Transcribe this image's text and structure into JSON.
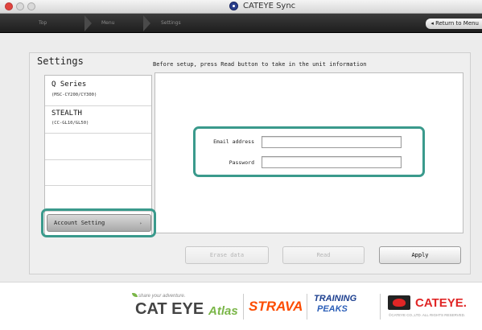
{
  "window": {
    "title": "CATEYE Sync"
  },
  "nav": {
    "crumbs": [
      "Top",
      "Menu",
      "Settings"
    ],
    "return_label": "◂ Return to Menu"
  },
  "settings": {
    "title": "Settings",
    "instruction": "Before setup, press Read button to take in the unit information"
  },
  "sidebar": {
    "items": [
      {
        "name": "Q Series",
        "sub": "(MSC-CY200/CY300)"
      },
      {
        "name": "STEALTH",
        "sub": "(CC-GL10/GL50)"
      }
    ],
    "account_button": {
      "label": "Account Setting",
      "arrow": "▸"
    }
  },
  "form": {
    "email_label": "Email address",
    "email_value": "",
    "password_label": "Password",
    "password_value": ""
  },
  "buttons": {
    "erase": "Erase data",
    "read": "Read",
    "apply": "Apply"
  },
  "footer": {
    "atlas_tagline": "share your adventure.",
    "atlas_brand": "CAT EYE",
    "atlas_word": "Atlas",
    "strava": "STRAVA",
    "tp_line1": "TRAINING",
    "tp_line2": "PEAKS",
    "cateye": "CATEYE.",
    "copyright": "©CATEYE CO.,LTD. ALL RIGHTS RESERVED."
  },
  "colors": {
    "highlight": "#3a9a8c",
    "strava": "#fc4c02",
    "cateye_red": "#e02626",
    "atlas_green": "#7ab648"
  }
}
